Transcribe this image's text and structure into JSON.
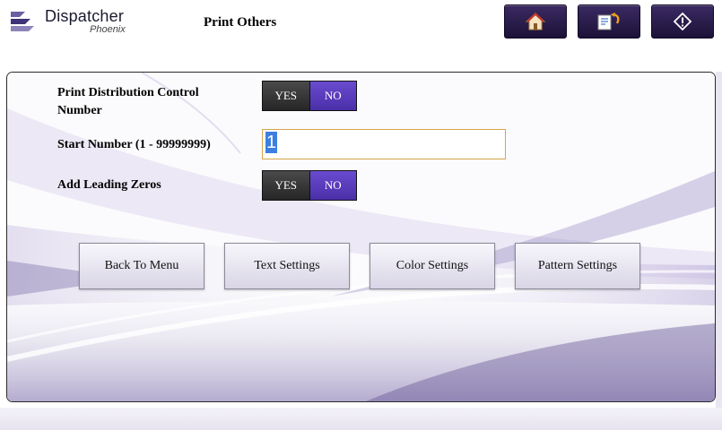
{
  "header": {
    "logo_name": "Dispatcher",
    "logo_subname": "Phoenix",
    "title": "Print Others",
    "buttons": [
      {
        "icon": "home-icon"
      },
      {
        "icon": "edit-back-icon"
      },
      {
        "icon": "info-diamond-icon"
      }
    ]
  },
  "form": {
    "distribution": {
      "label": "Print Distribution Control Number",
      "yes": "YES",
      "no": "NO",
      "selected": "NO"
    },
    "start_number": {
      "label": "Start Number (1 - 99999999)",
      "value": "1"
    },
    "leading_zeros": {
      "label": "Add Leading Zeros",
      "yes": "YES",
      "no": "NO",
      "selected": "NO"
    }
  },
  "actions": {
    "back": "Back To Menu",
    "text": "Text Settings",
    "color": "Color Settings",
    "pattern": "Pattern Settings"
  },
  "colors": {
    "accent": "#5a3dc0",
    "header_button": "#2a1d4e",
    "input_border": "#d4a64a"
  }
}
